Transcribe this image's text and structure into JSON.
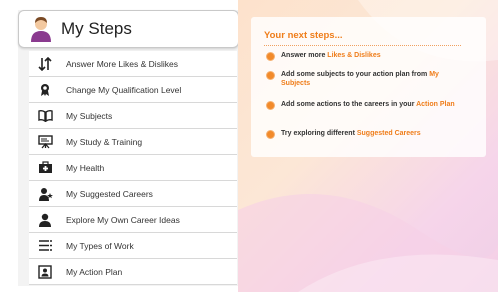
{
  "header": {
    "title": "My Steps"
  },
  "menu": [
    {
      "label": "Answer More Likes & Dislikes",
      "icon": "sort-arrows-icon"
    },
    {
      "label": "Change My Qualification Level",
      "icon": "award-ribbon-icon"
    },
    {
      "label": "My Subjects",
      "icon": "open-book-icon"
    },
    {
      "label": "My Study & Training",
      "icon": "presentation-board-icon"
    },
    {
      "label": "My Health",
      "icon": "first-aid-kit-icon"
    },
    {
      "label": "My Suggested Careers",
      "icon": "person-star-icon"
    },
    {
      "label": "Explore My Own Career Ideas",
      "icon": "person-icon"
    },
    {
      "label": "My Types of Work",
      "icon": "list-icon"
    },
    {
      "label": "My Action Plan",
      "icon": "portrait-frame-icon"
    }
  ],
  "next_steps": {
    "title": "Your next steps...",
    "items": [
      {
        "text": "Answer more ",
        "link": "Likes & Dislikes"
      },
      {
        "text": "Add some subjects to your action plan from ",
        "link": "My Subjects"
      },
      {
        "text": "Add some actions to the careers in your ",
        "link": "Action Plan"
      },
      {
        "text": "Try exploring different ",
        "link": "Suggested Careers"
      }
    ]
  },
  "colors": {
    "accent": "#ef7d1a",
    "panel_bg": "#f3f3f3"
  }
}
